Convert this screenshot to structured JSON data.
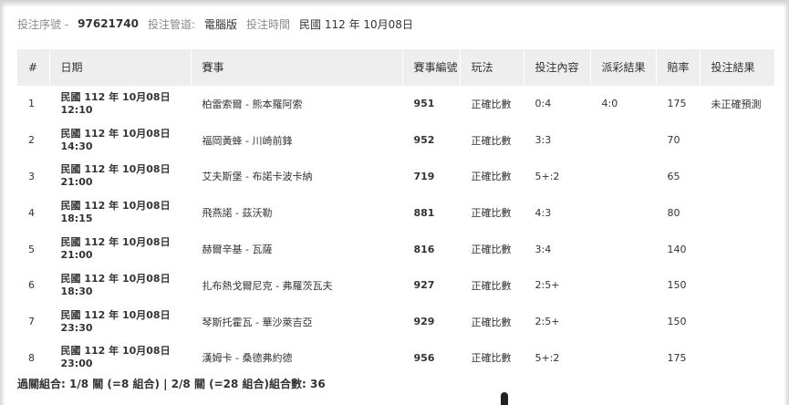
{
  "meta": {
    "order_label": "投注序號 -",
    "order_value": "97621740",
    "channel_label": "投注管道:",
    "channel_value": "電腦版",
    "time_label": "投注時間",
    "time_value": "民國 112 年 10月08日"
  },
  "table": {
    "headers": [
      "#",
      "日期",
      "賽事",
      "賽事編號",
      "玩法",
      "投注內容",
      "派彩結果",
      "賠率",
      "投注結果"
    ],
    "rows": [
      {
        "no": "1",
        "date1": "民國 112 年 10月08日",
        "date2": "12:10",
        "match": "柏雷索爾 - 熊本羅阿索",
        "code": "951",
        "play": "正確比數",
        "bet": "0:4",
        "payout": "4:0",
        "odds": "175",
        "result": "未正確預測"
      },
      {
        "no": "2",
        "date1": "民國 112 年 10月08日",
        "date2": "14:30",
        "match": "福岡黃蜂 - 川崎前鋒",
        "code": "952",
        "play": "正確比數",
        "bet": "3:3",
        "payout": "",
        "odds": "70",
        "result": ""
      },
      {
        "no": "3",
        "date1": "民國 112 年 10月08日",
        "date2": "21:00",
        "match": "艾夫斯堡 - 布諾卡波卡納",
        "code": "719",
        "play": "正確比數",
        "bet": "5+:2",
        "payout": "",
        "odds": "65",
        "result": ""
      },
      {
        "no": "4",
        "date1": "民國 112 年 10月08日",
        "date2": "18:15",
        "match": "飛燕諾 - 茲沃勒",
        "code": "881",
        "play": "正確比數",
        "bet": "4:3",
        "payout": "",
        "odds": "80",
        "result": ""
      },
      {
        "no": "5",
        "date1": "民國 112 年 10月08日",
        "date2": "21:00",
        "match": "赫爾辛基 - 瓦薩",
        "code": "816",
        "play": "正確比數",
        "bet": "3:4",
        "payout": "",
        "odds": "140",
        "result": ""
      },
      {
        "no": "6",
        "date1": "民國 112 年 10月08日",
        "date2": "18:30",
        "match": "扎布熱戈爾尼克 - 弗羅茨瓦夫",
        "code": "927",
        "play": "正確比數",
        "bet": "2:5+",
        "payout": "",
        "odds": "150",
        "result": ""
      },
      {
        "no": "7",
        "date1": "民國 112 年 10月08日",
        "date2": "23:30",
        "match": "琴斯托霍瓦 - 華沙萊吉亞",
        "code": "929",
        "play": "正確比數",
        "bet": "2:5+",
        "payout": "",
        "odds": "150",
        "result": ""
      },
      {
        "no": "8",
        "date1": "民國 112 年 10月08日",
        "date2": "23:00",
        "match": "漢姆卡 - 桑德弗約德",
        "code": "956",
        "play": "正確比數",
        "bet": "5+:2",
        "payout": "",
        "odds": "175",
        "result": ""
      }
    ]
  },
  "footer": {
    "text": "過關組合: 1/8 關 (=8 組合) | 2/8 關 (=28 組合)組合數: 36"
  }
}
